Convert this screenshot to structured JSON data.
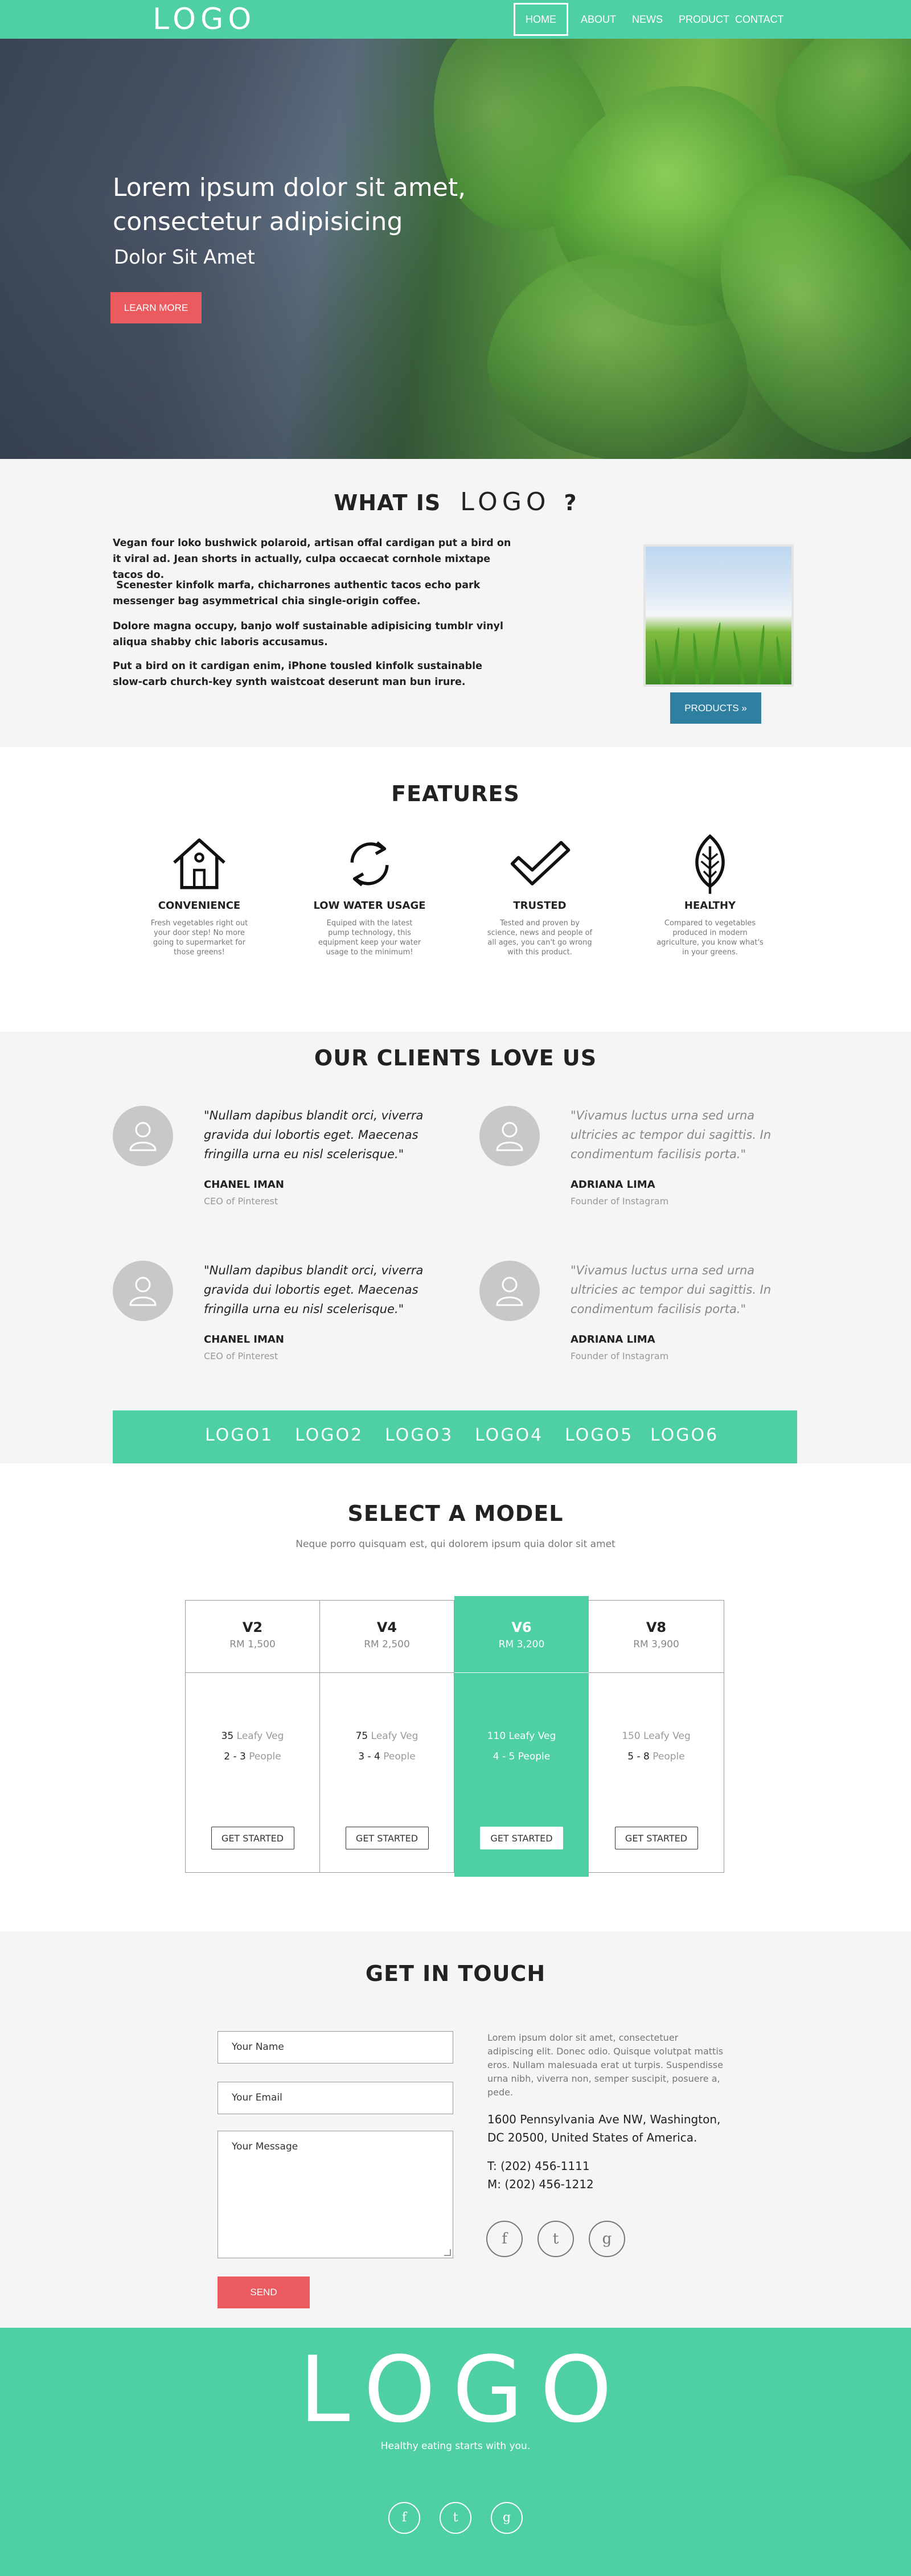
{
  "nav": {
    "logo": "LOGO",
    "items": [
      {
        "label": "HOME",
        "active": true
      },
      {
        "label": "ABOUT"
      },
      {
        "label": "NEWS"
      },
      {
        "label": "PRODUCT"
      },
      {
        "label": "CONTACT"
      }
    ]
  },
  "hero": {
    "title_line1": "Lorem ipsum dolor sit amet,",
    "title_line2": "consectetur adipisicing",
    "subtitle": "Dolor Sit Amet",
    "cta": "LEARN MORE"
  },
  "about": {
    "heading_pre": "WHAT IS",
    "heading_logo": "LOGO",
    "heading_post": "?",
    "paragraphs": [
      "Vegan four loko bushwick polaroid, artisan offal cardigan put a bird on it viral ad. Jean shorts in actually, culpa occaecat cornhole mixtape tacos do.",
      " Scenester kinfolk marfa, chicharrones authentic tacos echo park messenger bag asymmetrical chia single-origin coffee.",
      "Dolore magna occupy, banjo wolf sustainable adipisicing tumblr vinyl aliqua shabby chic laboris accusamus.",
      "Put a bird on it cardigan enim, iPhone tousled kinfolk sustainable slow-carb church-key synth waistcoat deserunt man bun irure."
    ],
    "products_button": "PRODUCTS »"
  },
  "features": {
    "heading": "FEATURES",
    "items": [
      {
        "icon": "house-icon",
        "title": "CONVENIENCE",
        "desc": "Fresh vegetables right out your door step! No more going to supermarket for those greens!"
      },
      {
        "icon": "recycle-icon",
        "title": "LOW WATER USAGE",
        "desc": "Equiped with the latest pump technology, this equipment keep your water usage to the minimum!"
      },
      {
        "icon": "checkmark-icon",
        "title": "TRUSTED",
        "desc": "Tested and proven by science, news and people of all ages, you can't go wrong with this product."
      },
      {
        "icon": "leaf-icon",
        "title": "HEALTHY",
        "desc": "Compared to vegetables produced in modern agriculture, you know what's in your greens."
      }
    ]
  },
  "clients": {
    "heading": "OUR CLIENTS LOVE US",
    "testimonials": [
      {
        "quote": "\"Nullam dapibus blandit orci, viverra gravida dui lobortis eget. Maecenas fringilla urna eu nisl scelerisque.\"",
        "name": "CHANEL IMAN",
        "role": "CEO of Pinterest",
        "quote_color": "#222222"
      },
      {
        "quote": "\"Vivamus luctus urna sed urna ultricies ac tempor dui sagittis. In condimentum facilisis porta.\"",
        "name": "ADRIANA LIMA",
        "role": "Founder of Instagram",
        "quote_color": "#888888"
      },
      {
        "quote": "\"Nullam dapibus blandit orci, viverra gravida dui lobortis eget. Maecenas fringilla urna eu nisl scelerisque.\"",
        "name": "CHANEL IMAN",
        "role": "CEO of Pinterest",
        "quote_color": "#222222"
      },
      {
        "quote": "\"Vivamus luctus urna sed urna ultricies ac tempor dui sagittis. In condimentum facilisis porta.\"",
        "name": "ADRIANA LIMA",
        "role": "Founder of Instagram",
        "quote_color": "#888888"
      }
    ],
    "logos": [
      "LOGO1",
      "LOGO2",
      "LOGO3",
      "LOGO4",
      "LOGO5",
      "LOGO6"
    ]
  },
  "models": {
    "heading": "SELECT A MODEL",
    "description": "Neque porro quisquam est, qui dolorem ipsum quia dolor sit amet",
    "button_label": "GET STARTED",
    "plans": [
      {
        "name": "V2",
        "price": "RM 1,500",
        "veg_count": "35",
        "veg_label": "Leafy Veg",
        "people_count": "2 - 3",
        "people_label": "People",
        "highlight": false
      },
      {
        "name": "V4",
        "price": "RM 2,500",
        "veg_count": "75",
        "veg_label": "Leafy Veg",
        "people_count": "3 - 4",
        "people_label": "People",
        "highlight": false
      },
      {
        "name": "V6",
        "price": "RM 3,200",
        "veg_count": "110",
        "veg_label": "Leafy Veg",
        "people_count": "4 - 5",
        "people_label": "People",
        "highlight": true
      },
      {
        "name": "V8",
        "price": "RM 3,900",
        "veg_count": "150",
        "veg_label": "Leafy Veg",
        "people_count": "5 - 8",
        "people_label": "People",
        "highlight": false
      }
    ]
  },
  "contact": {
    "heading": "GET IN TOUCH",
    "name_placeholder": "Your Name",
    "email_placeholder": "Your Email",
    "message_placeholder": "Your Message",
    "send": "SEND",
    "blurb": "Lorem ipsum dolor sit amet, consectetuer adipiscing elit. Donec odio. Quisque volutpat mattis eros. Nullam malesuada erat ut turpis. Suspendisse urna nibh, viverra non, semper suscipit, posuere a, pede.",
    "address_line1": "1600 Pennsylvania Ave NW, Washington,",
    "address_line2": "DC 20500, United States of America.",
    "phone_t": "T: (202) 456-1111",
    "phone_m": "M: (202) 456-1212",
    "social": [
      {
        "icon": "facebook-icon",
        "glyph": "f"
      },
      {
        "icon": "twitter-icon",
        "glyph": "t"
      },
      {
        "icon": "google-plus-icon",
        "glyph": "g"
      }
    ]
  },
  "footer": {
    "logo": "LOGO",
    "tagline": "Healthy eating starts with you.",
    "social": [
      {
        "icon": "facebook-icon",
        "glyph": "f"
      },
      {
        "icon": "twitter-icon",
        "glyph": "t"
      },
      {
        "icon": "google-plus-icon",
        "glyph": "g"
      }
    ]
  },
  "colors": {
    "brand_green": "#4ecfa6",
    "accent_red": "#eb5a5f",
    "button_blue": "#2e7fa0",
    "section_grey": "#f5f5f5"
  }
}
